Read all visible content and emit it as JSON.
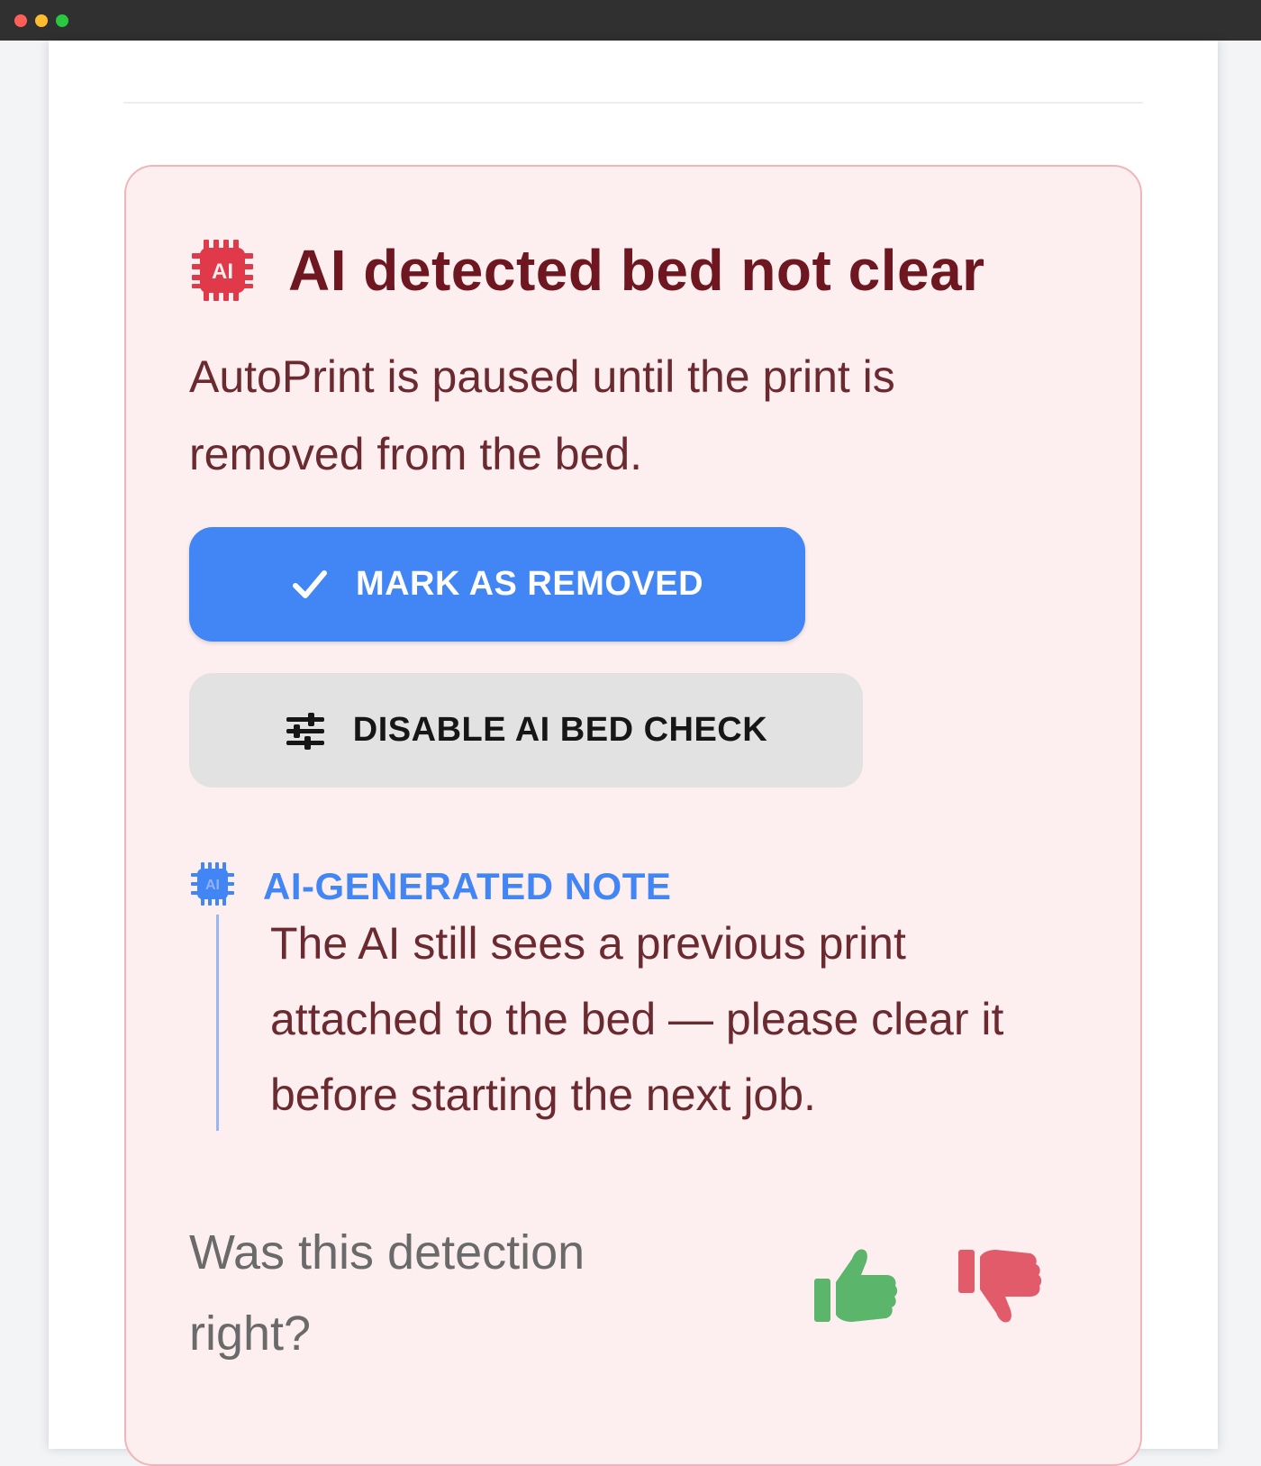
{
  "window": {
    "controls": [
      "close",
      "minimize",
      "maximize"
    ]
  },
  "alert": {
    "icon": "ai-chip-icon",
    "title": "AI detected bed not clear",
    "body": "AutoPrint is paused until the print is removed from the bed.",
    "primary_button": {
      "label": "MARK AS REMOVED",
      "icon": "check-icon"
    },
    "secondary_button": {
      "label": "DISABLE AI BED CHECK",
      "icon": "sliders-icon"
    },
    "note": {
      "icon": "ai-chip-icon",
      "label": "AI-GENERATED NOTE",
      "text": "The AI still sees a previous print attached to the bed — please clear it before starting the next job."
    },
    "feedback": {
      "question": "Was this detection right?",
      "thumbs_up_icon": "thumbs-up-icon",
      "thumbs_down_icon": "thumbs-down-icon"
    }
  },
  "colors": {
    "alert_bg": "#fdeff0",
    "alert_border": "#f1b5b9",
    "title": "#6e1720",
    "primary": "#4285f4",
    "danger_icon": "#e03a4a",
    "thumb_up": "#5bb56b",
    "thumb_down": "#e25b6a"
  }
}
